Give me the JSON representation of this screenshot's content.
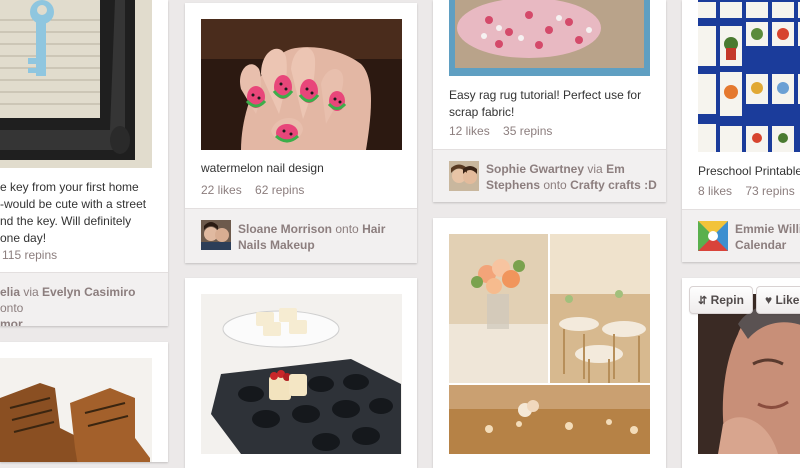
{
  "pins": {
    "key_frame": {
      "desc_lines": [
        "e key from your first home",
        "-would be cute with a street",
        "nd the key. Will definitely",
        "one day!"
      ],
      "stats": {
        "likes": "",
        "repins": "115 repins"
      },
      "attribution": {
        "user": "elia",
        "via_word": "via",
        "via_user": "Evelyn Casimiro",
        "onto_word": "onto",
        "board": "mor"
      }
    },
    "watermelon_nails": {
      "desc": "watermelon nail design",
      "stats": {
        "likes": "22 likes",
        "repins": "62 repins"
      },
      "attribution": {
        "user": "Sloane Morrison",
        "onto_word": "onto",
        "board": "Hair Nails Makeup"
      }
    },
    "rag_rug": {
      "desc_lines": [
        "Easy rag rug tutorial! Perfect use for",
        "scrap fabric!"
      ],
      "stats": {
        "likes": "12 likes",
        "repins": "35 repins"
      },
      "attribution": {
        "user": "Sophie Gwartney",
        "via_word": "via",
        "via_user_1": "Em",
        "via_user_2": "Stephens",
        "onto_word": "onto",
        "board": "Crafty crafts :D"
      }
    },
    "preschool": {
      "desc": "Preschool Printables",
      "stats": {
        "likes": "8 likes",
        "repins": "73 repins"
      },
      "attribution": {
        "user": "Emmie Willi",
        "board": "Calendar"
      }
    }
  },
  "buttons": {
    "repin": "Repin",
    "like": "Like"
  },
  "colors": {
    "background": "#ece9e9",
    "card": "#ffffff",
    "footer": "#f2f0f0",
    "meta_text": "#8c7e7e",
    "rug_frame": "#5f9fc2",
    "calendar_blue": "#1b3c9b"
  }
}
